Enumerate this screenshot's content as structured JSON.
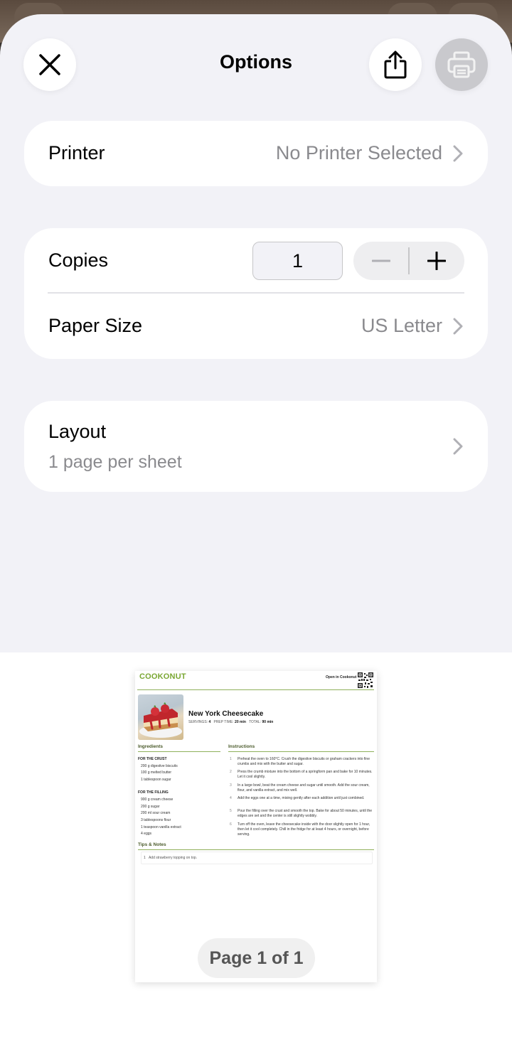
{
  "header": {
    "title": "Options",
    "close_icon": "close-icon",
    "share_icon": "share-icon",
    "print_icon": "printer-icon"
  },
  "printer": {
    "label": "Printer",
    "value": "No Printer Selected"
  },
  "copies": {
    "label": "Copies",
    "value": "1"
  },
  "paper_size": {
    "label": "Paper Size",
    "value": "US Letter"
  },
  "layout": {
    "label": "Layout",
    "value": "1 page per sheet"
  },
  "preview": {
    "logo": "COOKONUT",
    "open_in": "Open in Cookonut",
    "recipe_title": "New York Cheesecake",
    "servings_label": "SERVINGS:",
    "servings": "4",
    "prep_label": "PREP TIME:",
    "prep": "20 min",
    "total_label": "TOTAL:",
    "total": "90 min",
    "ingredients_heading": "Ingredients",
    "instructions_heading": "Instructions",
    "crust_heading": "FOR THE CRUST",
    "crust_items": [
      "200 g digestive biscuits",
      "100 g melted butter",
      "1 tablespoon sugar"
    ],
    "filling_heading": "FOR THE FILLING",
    "filling_items": [
      "900 g cream cheese",
      "200 g sugar",
      "200 ml sour cream",
      "3 tablespoons flour",
      "1 teaspoon vanilla extract",
      "4 eggs"
    ],
    "steps": [
      "Preheat the oven to 160°C. Crush the digestive biscuits or graham crackers into fine crumbs and mix with the butter and sugar.",
      "Press the crumb mixture into the bottom of a springform pan and bake for 10 minutes. Let it cool slightly.",
      "In a large bowl, beat the cream cheese and sugar until smooth. Add the sour cream, flour, and vanilla extract, and mix well.",
      "Add the eggs one at a time, mixing gently after each addition until just combined.",
      "Pour the filling over the crust and smooth the top. Bake for about 50 minutes, until the edges are set and the center is still slightly wobbly.",
      "Turn off the oven, leave the cheesecake inside with the door slightly open for 1 hour, then let it cool completely. Chill in the fridge for at least 4 hours, or overnight, before serving."
    ],
    "tips_heading": "Tips & Notes",
    "tips": [
      "Add strawberry topping on top."
    ],
    "page_indicator": "Page 1 of 1"
  }
}
